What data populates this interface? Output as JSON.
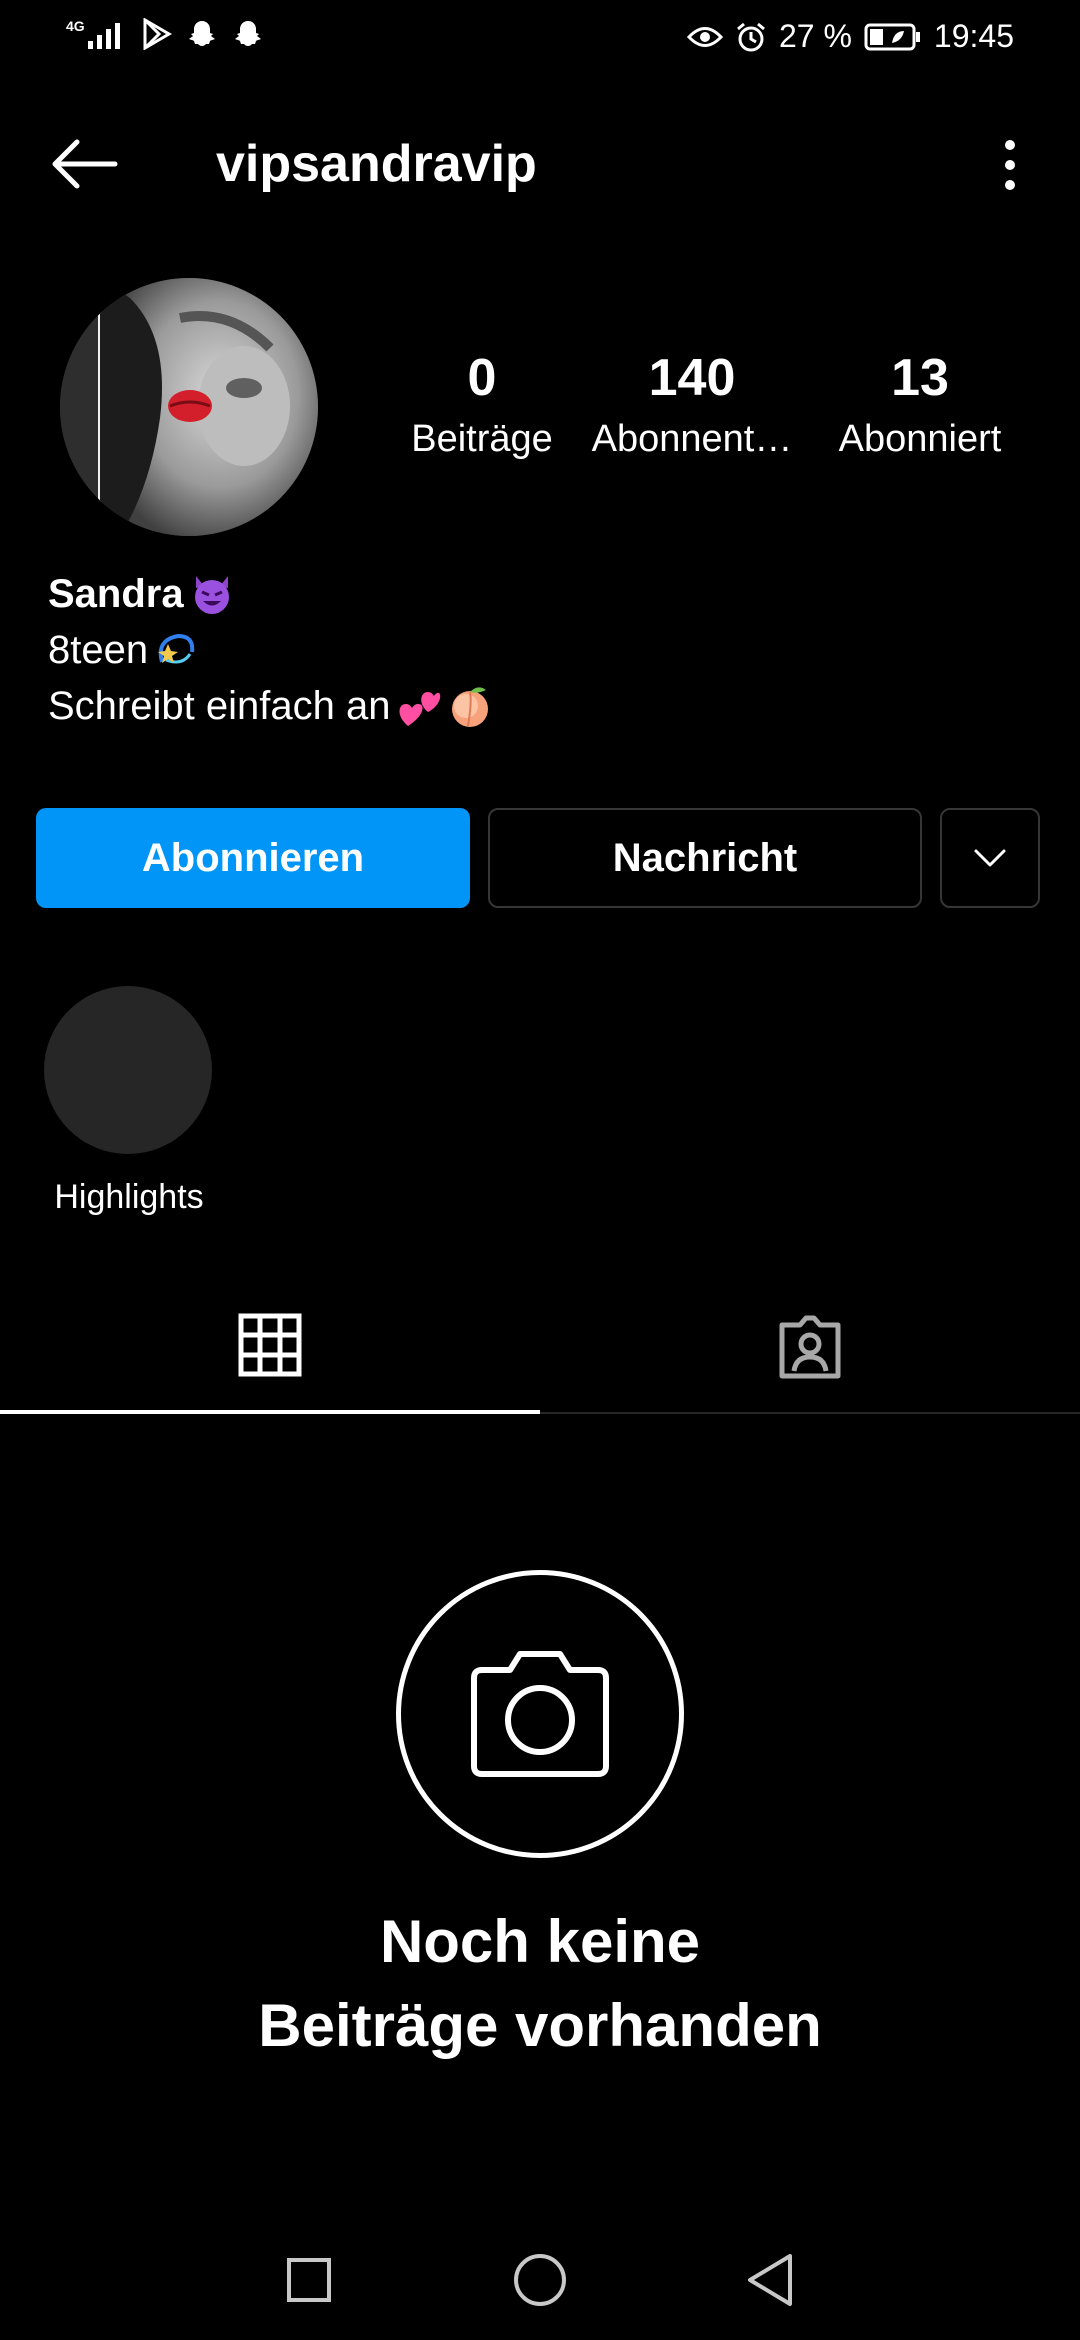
{
  "status_bar": {
    "network": "4G",
    "battery": "27 %",
    "time": "19:45"
  },
  "header": {
    "username": "vipsandravip",
    "back_icon": "arrow-left-icon",
    "more_icon": "more-vertical-icon"
  },
  "profile": {
    "stats": [
      {
        "value": "0",
        "label": "Beiträge"
      },
      {
        "value": "140",
        "label": "Abonnent…"
      },
      {
        "value": "13",
        "label": "Abonniert"
      }
    ],
    "bio": {
      "name": "Sandra",
      "line1": "8teen",
      "line2": "Schreibt einfach an"
    }
  },
  "actions": {
    "follow_label": "Abonnieren",
    "message_label": "Nachricht",
    "follow_color": "#0095f6"
  },
  "highlights": [
    {
      "label": "Highlights"
    }
  ],
  "empty_state": {
    "line1": "Noch keine",
    "line2": "Beiträge vorhanden"
  }
}
